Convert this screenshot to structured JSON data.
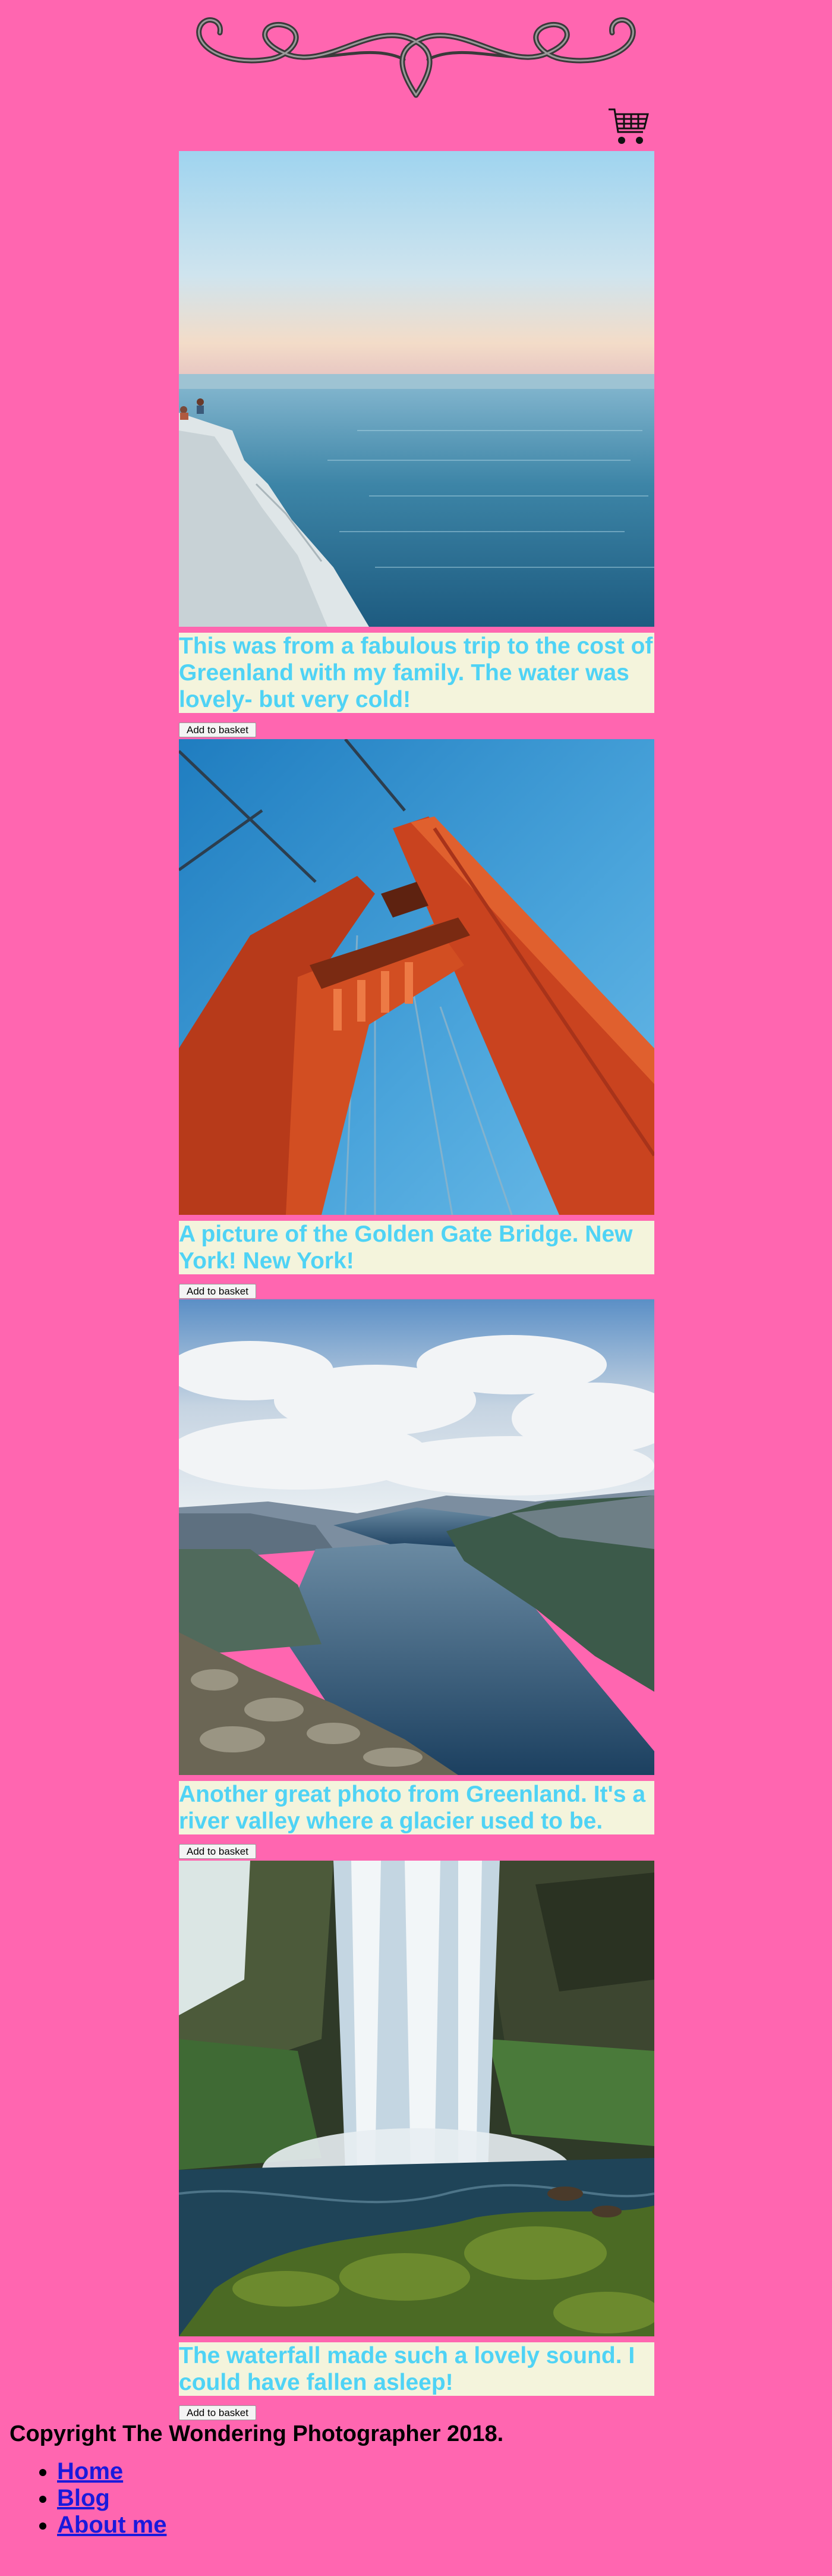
{
  "header": {
    "logo_icon": "ornamental-flourish-logo",
    "cart_icon": "shopping-cart-icon"
  },
  "items": [
    {
      "caption": "This was from a fabulous trip to the cost of Greenland with my family. The water was lovely- but very cold!",
      "button_label": "Add to basket"
    },
    {
      "caption": "A picture of the Golden Gate Bridge. New York! New York!",
      "button_label": "Add to basket"
    },
    {
      "caption": "Another great photo from Greenland. It's a river valley where a glacier used to be.",
      "button_label": "Add to basket"
    },
    {
      "caption": "The waterfall made such a lovely sound. I could have fallen asleep!",
      "button_label": "Add to basket"
    }
  ],
  "footer": {
    "copyright": "Copyright The Wondering Photographer 2018.",
    "nav": [
      {
        "label": "Home"
      },
      {
        "label": "Blog"
      },
      {
        "label": "About me"
      }
    ]
  }
}
